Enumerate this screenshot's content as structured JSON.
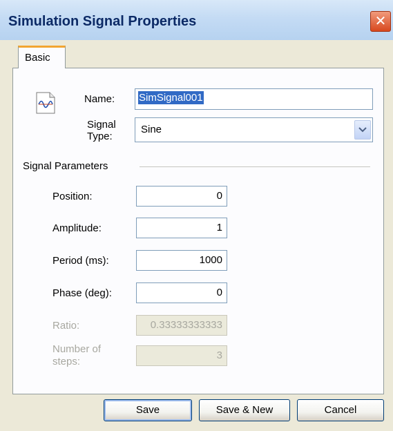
{
  "window": {
    "title": "Simulation Signal Properties",
    "close_glyph": "✕"
  },
  "tabs": [
    {
      "label": "Basic",
      "active": true
    }
  ],
  "form": {
    "icon": "signal-wave-icon",
    "name_label": "Name:",
    "name_value": "SimSignal001",
    "type_label": "Signal Type:",
    "type_value": "Sine"
  },
  "parameters": {
    "section_label": "Signal Parameters",
    "position": {
      "label": "Position:",
      "value": "0"
    },
    "amplitude": {
      "label": "Amplitude:",
      "value": "1"
    },
    "period": {
      "label": "Period (ms):",
      "value": "1000"
    },
    "phase": {
      "label": "Phase (deg):",
      "value": "0"
    },
    "ratio": {
      "label": "Ratio:",
      "value": "0.33333333333",
      "disabled": true
    },
    "steps": {
      "label": "Number of steps:",
      "value": "3",
      "disabled": true
    }
  },
  "buttons": {
    "save": "Save",
    "save_new": "Save & New",
    "cancel": "Cancel"
  },
  "colors": {
    "title_text": "#0c2a66",
    "tab_accent": "#f2a531",
    "selection": "#316ac5",
    "close_button": "#d8481e"
  }
}
